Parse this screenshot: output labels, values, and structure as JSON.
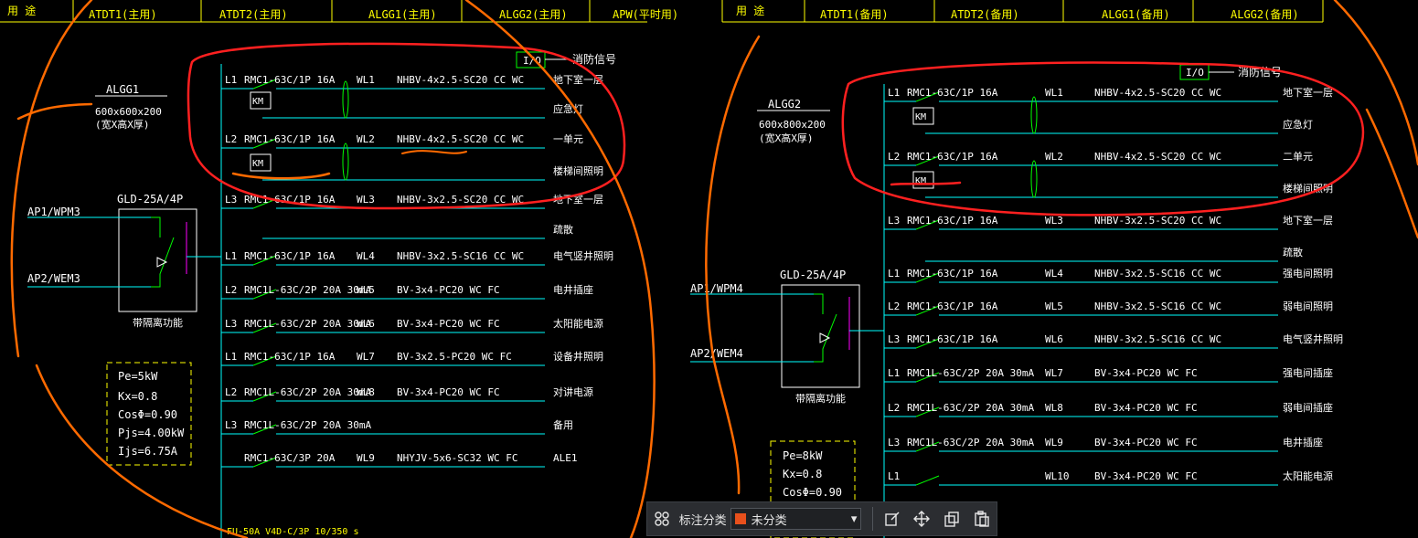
{
  "header": {
    "left": [
      {
        "use": "用  途"
      },
      {
        "code": "ATDT1(主用)"
      },
      {
        "code": "ATDT2(主用)"
      },
      {
        "code": "ALGG1(主用)"
      },
      {
        "code": "ALGG2(主用)"
      },
      {
        "code": "APW(平时用)"
      }
    ],
    "right": [
      {
        "use": "用  途"
      },
      {
        "code": "ATDT1(备用)"
      },
      {
        "code": "ATDT2(备用)"
      },
      {
        "code": "ALGG1(备用)"
      },
      {
        "code": "ALGG2(备用)"
      }
    ]
  },
  "left_panel": {
    "name": "ALGG1",
    "size": "600x600x200",
    "size_note": "(宽X高X厚)",
    "switch": "GLD-25A/4P",
    "switch_note": "带隔离功能",
    "in1": "AP1/WPM3",
    "in2": "AP2/WEM3",
    "io": "I/O",
    "fire_signal": "消防信号",
    "calc": [
      "Pe=5kW",
      "Kx=0.8",
      "CosΦ=0.90",
      "Pjs=4.00kW",
      "Ijs=6.75A"
    ],
    "bottom": "FU-50A   V4D-C/3P   10/350   s",
    "circuits": [
      {
        "phase": "L1",
        "breaker": "RMC1-63C/1P 16A",
        "wl": "WL1",
        "cable": "NHBV-4x2.5-SC20 CC WC",
        "dest": "地下室一层"
      },
      {
        "phase": "",
        "breaker": "",
        "wl": "",
        "cable": "",
        "dest": "应急灯"
      },
      {
        "phase": "L2",
        "breaker": "RMC1-63C/1P 16A",
        "wl": "WL2",
        "cable": "NHBV-4x2.5-SC20 CC WC",
        "dest": "一单元"
      },
      {
        "phase": "",
        "breaker": "",
        "wl": "",
        "cable": "",
        "dest": "楼梯间照明"
      },
      {
        "phase": "L3",
        "breaker": "RMC1-63C/1P 16A",
        "wl": "WL3",
        "cable": "NHBV-3x2.5-SC20 CC WC",
        "dest": "地下室一层"
      },
      {
        "phase": "",
        "breaker": "",
        "wl": "",
        "cable": "",
        "dest": "疏散"
      },
      {
        "phase": "L1",
        "breaker": "RMC1-63C/1P 16A",
        "wl": "WL4",
        "cable": "NHBV-3x2.5-SC16 CC WC",
        "dest": "电气竖井照明"
      },
      {
        "phase": "L2",
        "breaker": "RMC1L-63C/2P 20A 30mA",
        "wl": "WL5",
        "cable": "BV-3x4-PC20 WC FC",
        "dest": "电井插座"
      },
      {
        "phase": "L3",
        "breaker": "RMC1L-63C/2P 20A 30mA",
        "wl": "WL6",
        "cable": "BV-3x4-PC20 WC FC",
        "dest": "太阳能电源"
      },
      {
        "phase": "L1",
        "breaker": "RMC1-63C/1P 16A",
        "wl": "WL7",
        "cable": "BV-3x2.5-PC20 WC FC",
        "dest": "设备井照明"
      },
      {
        "phase": "L2",
        "breaker": "RMC1L-63C/2P 20A 30mA",
        "wl": "WL8",
        "cable": "BV-3x4-PC20 WC FC",
        "dest": "对讲电源"
      },
      {
        "phase": "L3",
        "breaker": "RMC1L-63C/2P 20A 30mA",
        "wl": "",
        "cable": "",
        "dest": "备用"
      },
      {
        "phase": "",
        "breaker": "RMC1-63C/3P 20A",
        "wl": "WL9",
        "cable": "NHYJV-5x6-SC32 WC FC",
        "dest": "ALE1"
      }
    ]
  },
  "right_panel": {
    "name": "ALGG2",
    "size": "600x800x200",
    "size_note": "(宽X高X厚)",
    "switch": "GLD-25A/4P",
    "switch_note": "带隔离功能",
    "in1": "AP1/WPM4",
    "in2": "AP2/WEM4",
    "io": "I/O",
    "fire_signal": "消防信号",
    "calc": [
      "Pe=8kW",
      "Kx=0.8",
      "CosΦ=0.90"
    ],
    "circuits": [
      {
        "phase": "L1",
        "breaker": "RMC1-63C/1P 16A",
        "wl": "WL1",
        "cable": "NHBV-4x2.5-SC20 CC WC",
        "dest": "地下室一层"
      },
      {
        "phase": "",
        "breaker": "",
        "wl": "",
        "cable": "",
        "dest": "应急灯"
      },
      {
        "phase": "L2",
        "breaker": "RMC1-63C/1P 16A",
        "wl": "WL2",
        "cable": "NHBV-4x2.5-SC20 CC WC",
        "dest": "二单元"
      },
      {
        "phase": "",
        "breaker": "",
        "wl": "",
        "cable": "",
        "dest": "楼梯间照明"
      },
      {
        "phase": "L3",
        "breaker": "RMC1-63C/1P 16A",
        "wl": "WL3",
        "cable": "NHBV-3x2.5-SC20 CC WC",
        "dest": "地下室一层"
      },
      {
        "phase": "",
        "breaker": "",
        "wl": "",
        "cable": "",
        "dest": "疏散"
      },
      {
        "phase": "L1",
        "breaker": "RMC1-63C/1P 16A",
        "wl": "WL4",
        "cable": "NHBV-3x2.5-SC16 CC WC",
        "dest": "强电间照明"
      },
      {
        "phase": "L2",
        "breaker": "RMC1-63C/1P 16A",
        "wl": "WL5",
        "cable": "NHBV-3x2.5-SC16 CC WC",
        "dest": "弱电间照明"
      },
      {
        "phase": "L3",
        "breaker": "RMC1-63C/1P 16A",
        "wl": "WL6",
        "cable": "NHBV-3x2.5-SC16 CC WC",
        "dest": "电气竖井照明"
      },
      {
        "phase": "L1",
        "breaker": "RMC1L-63C/2P 20A 30mA",
        "wl": "WL7",
        "cable": "BV-3x4-PC20 WC FC",
        "dest": "强电间插座"
      },
      {
        "phase": "L2",
        "breaker": "RMC1L-63C/2P 20A 30mA",
        "wl": "WL8",
        "cable": "BV-3x4-PC20 WC FC",
        "dest": "弱电间插座"
      },
      {
        "phase": "L3",
        "breaker": "RMC1L-63C/2P 20A 30mA",
        "wl": "WL9",
        "cable": "BV-3x4-PC20 WC FC",
        "dest": "电井插座"
      },
      {
        "phase": "L1",
        "breaker": "",
        "wl": "WL10",
        "cable": "BV-3x4-PC20 WC FC",
        "dest": "太阳能电源"
      }
    ],
    "partial_breaker": "30mA"
  },
  "km_label": "KM",
  "toolbar": {
    "label": "标注分类",
    "selected": "未分类",
    "selected_color": "#e8501c"
  },
  "colors": {
    "bg": "#000000",
    "text": "#ffffff",
    "bus": "#00ffff",
    "breaker": "#00ff00",
    "frame": "#ffff00",
    "magenta": "#ff00ff",
    "markup": "#ff6a00",
    "redmark": "#ff1a1a"
  }
}
